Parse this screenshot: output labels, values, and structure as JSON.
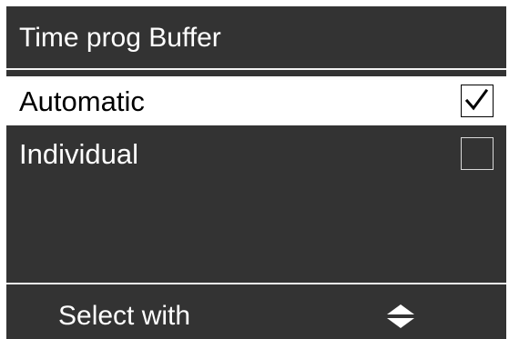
{
  "header": {
    "title": "Time prog Buffer"
  },
  "options": [
    {
      "label": "Automatic",
      "checked": true,
      "selected": true
    },
    {
      "label": "Individual",
      "checked": false,
      "selected": false
    }
  ],
  "footer": {
    "hint": "Select with",
    "icon": "up-down-arrows-icon"
  },
  "colors": {
    "background": "#333333",
    "text": "#ffffff",
    "selected_background": "#ffffff",
    "selected_text": "#000000"
  }
}
